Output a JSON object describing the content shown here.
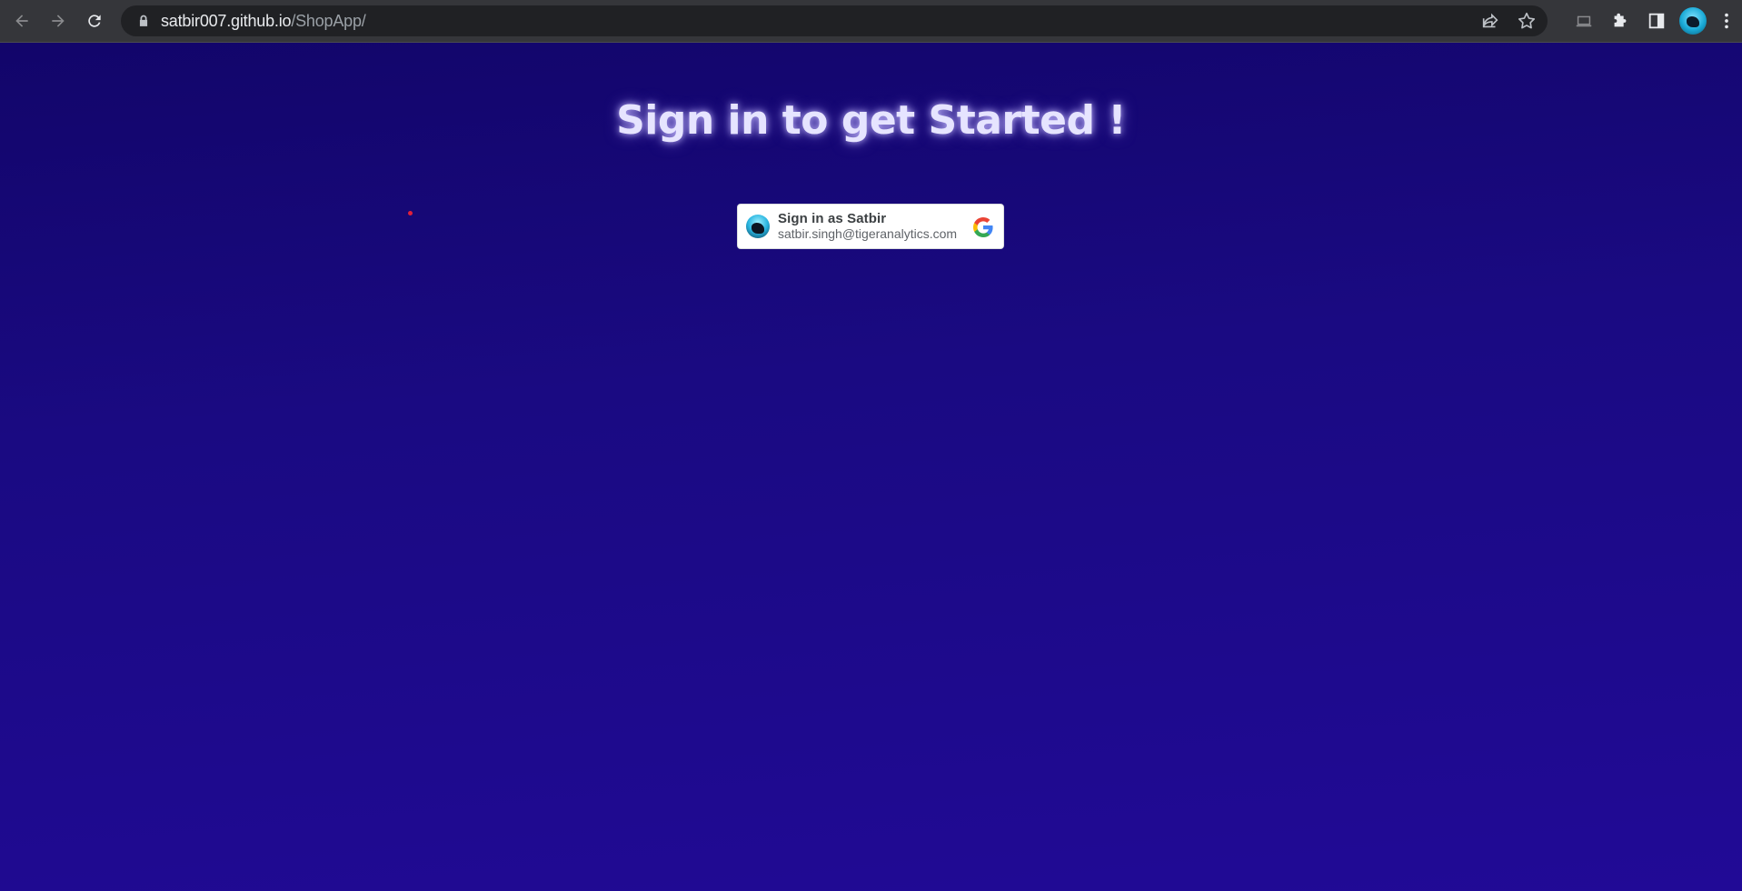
{
  "browser": {
    "url_host": "satbir007.github.io",
    "url_path": "/ShopApp/",
    "icons": {
      "back": "arrow-back-icon",
      "forward": "arrow-forward-icon",
      "reload": "reload-icon",
      "lock": "lock-icon",
      "share": "share-icon",
      "bookmark": "star-icon",
      "cast": "laptop-icon",
      "extensions": "puzzle-icon",
      "side_panel": "side-panel-icon",
      "menu": "kebab-menu-icon"
    }
  },
  "page": {
    "heading": "Sign in to get Started !",
    "background_colors": [
      "#12056a",
      "#210a96"
    ]
  },
  "google_signin": {
    "label": "Sign in as Satbir",
    "email": "satbir.singh@tigeranalytics.com"
  }
}
